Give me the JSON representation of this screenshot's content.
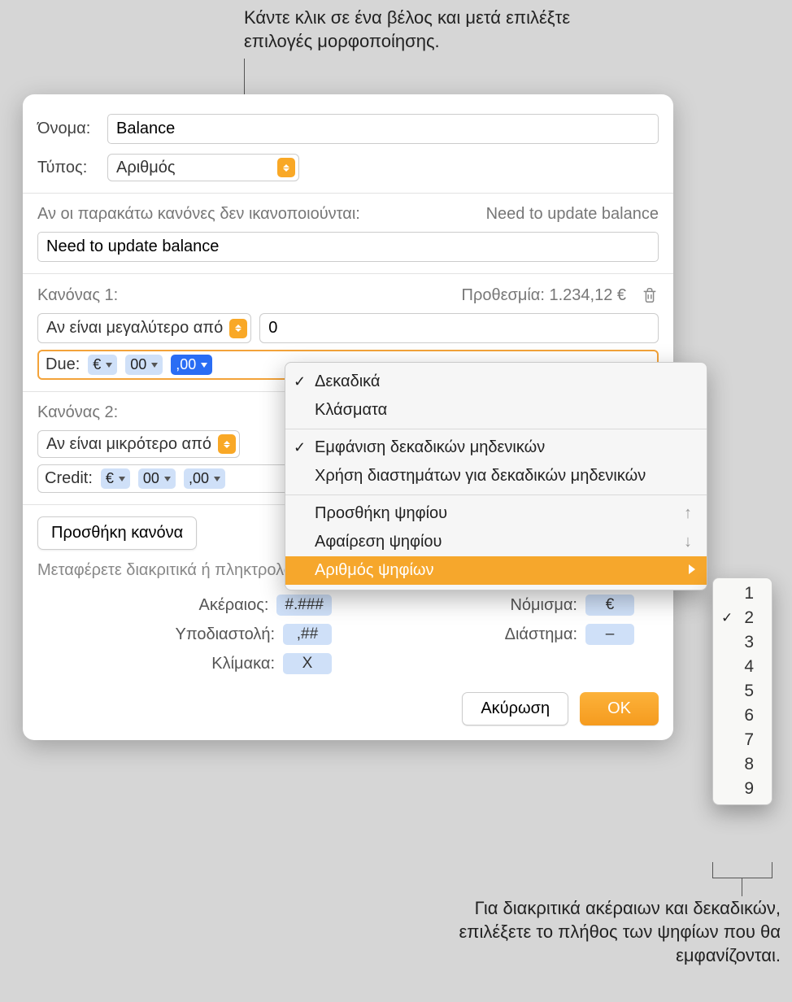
{
  "callout_top": "Κάντε κλικ σε ένα βέλος και μετά επιλέξτε επιλογές μορφοποίησης.",
  "callout_bottom": "Για διακριτικά ακέραιων και δεκαδικών, επιλέξετε το πλήθος των ψηφίων που θα εμφανίζονται.",
  "dialog": {
    "name_label": "Όνομα:",
    "name_value": "Balance",
    "type_label": "Τύπος:",
    "type_value": "Αριθμός",
    "fallback_heading": "Αν οι παρακάτω κανόνες δεν ικανοποιούνται:",
    "fallback_right": "Need to update balance",
    "fallback_value": "Need to update balance",
    "rule1": {
      "title": "Κανόνας 1:",
      "preview": "Προθεσμία: 1.234,12 €",
      "condition": "Αν είναι μεγαλύτερο από",
      "comparator": "0",
      "tokens": {
        "prefix": "Due:",
        "currency": "€",
        "integers": "00",
        "decimals": ",00"
      }
    },
    "rule2": {
      "title": "Κανόνας 2:",
      "condition": "Αν είναι μικρότερο από",
      "tokens": {
        "prefix": "Credit:",
        "currency": "€",
        "integers": "00",
        "decimals": ",00"
      }
    },
    "add_rule": "Προσθήκη κανόνα",
    "hint": "Μεταφέρετε διακριτικά ή πληκτρολογήστε κείμενο στο πεδίο από πάνω.",
    "legend": {
      "integer_label": "Ακέραιος:",
      "integer_value": "#.###",
      "decimal_label": "Υποδιαστολή:",
      "decimal_value": ",##",
      "scale_label": "Κλίμακα:",
      "scale_value": "X",
      "currency_label": "Νόμισμα:",
      "currency_value": "€",
      "space_label": "Διάστημα:",
      "space_value": "–"
    },
    "cancel": "Ακύρωση",
    "ok": "OK"
  },
  "ctx_menu": {
    "decimals": "Δεκαδικά",
    "fractions": "Κλάσματα",
    "show_zeros": "Εμφάνιση δεκαδικών μηδενικών",
    "use_spaces": "Χρήση διαστημάτων για δεκαδικών μηδενικών",
    "add_digit": "Προσθήκη ψηφίου",
    "remove_digit": "Αφαίρεση ψηφίου",
    "num_digits": "Αριθμός ψηφίων"
  },
  "digits": {
    "d1": "1",
    "d2": "2",
    "d3": "3",
    "d4": "4",
    "d5": "5",
    "d6": "6",
    "d7": "7",
    "d8": "8",
    "d9": "9",
    "selected": "2"
  }
}
